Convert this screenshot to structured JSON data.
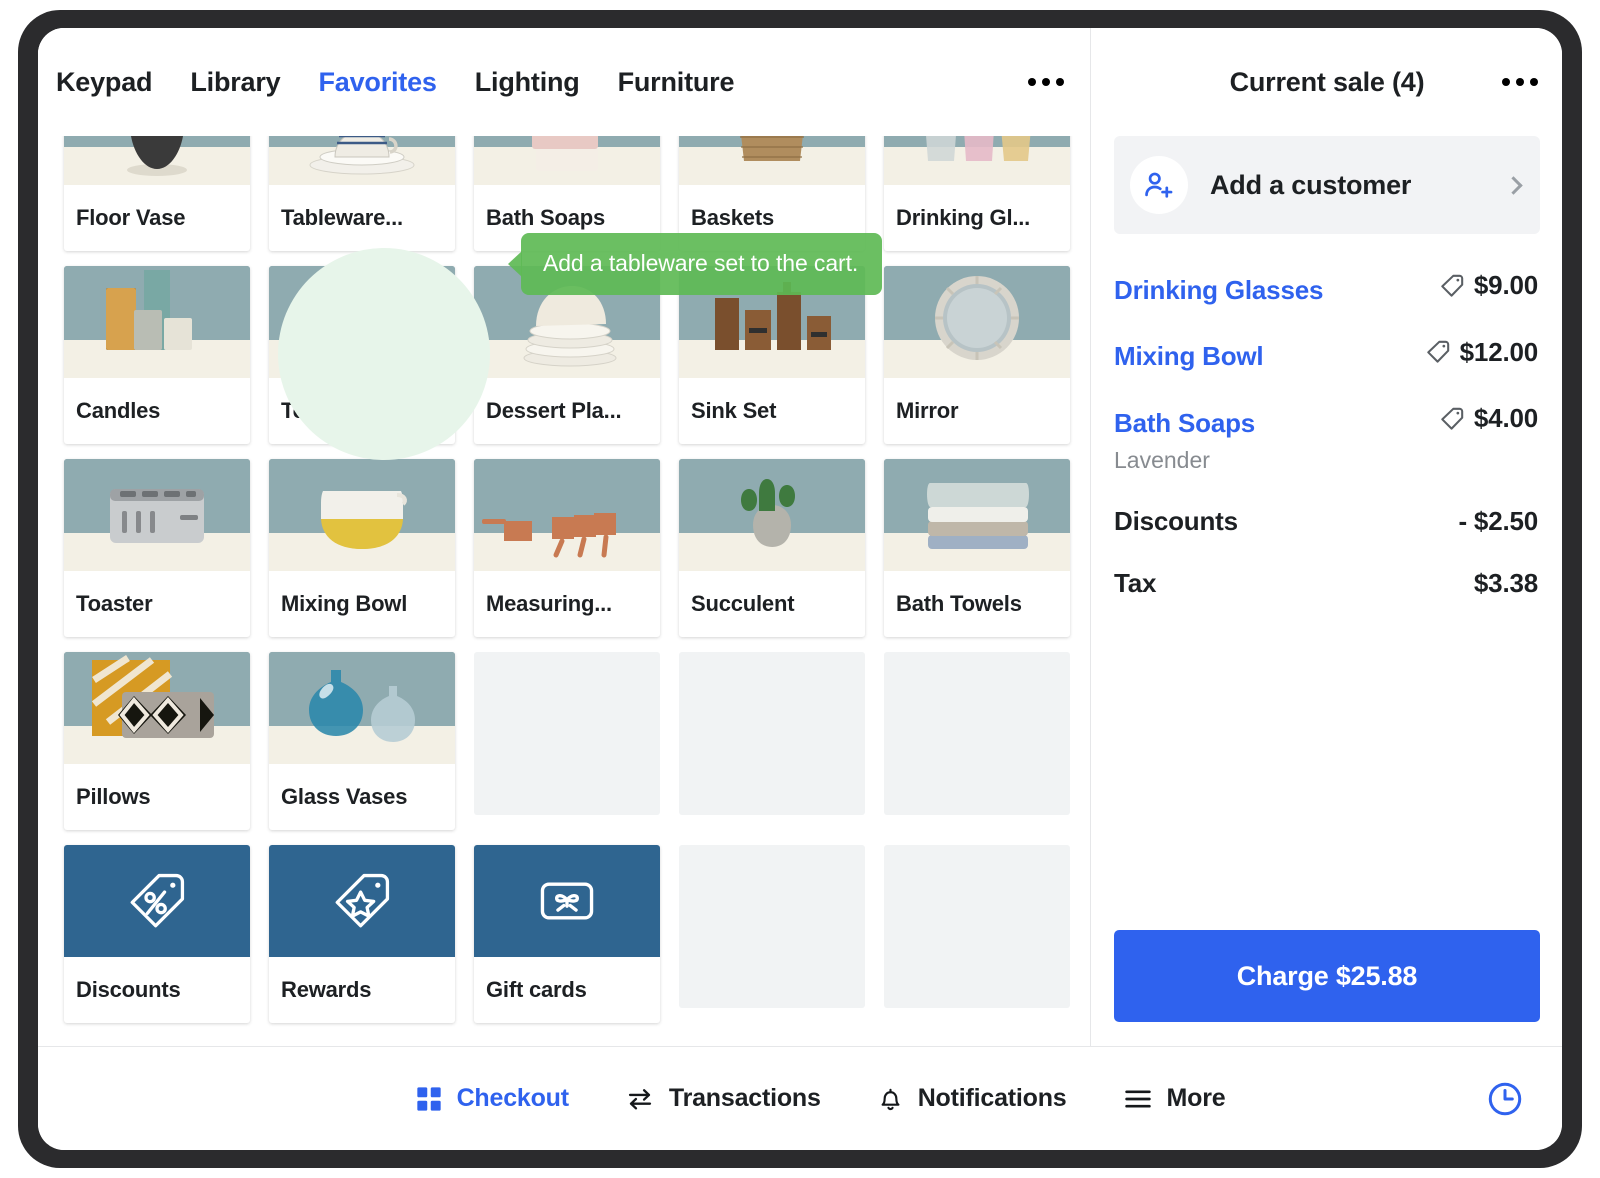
{
  "tabs": [
    {
      "label": "Keypad",
      "active": false
    },
    {
      "label": "Library",
      "active": false
    },
    {
      "label": "Favorites",
      "active": true
    },
    {
      "label": "Lighting",
      "active": false
    },
    {
      "label": "Furniture",
      "active": false
    }
  ],
  "overflow_menu_label": "•••",
  "tooltip": {
    "text": "Add a tableware set to the cart.",
    "color": "#5eba55"
  },
  "grid": {
    "tiles": [
      {
        "label": "Floor Vase",
        "kind": "product",
        "art": "floor-vase"
      },
      {
        "label": "Tableware...",
        "kind": "product",
        "art": "tableware",
        "highlighted": true
      },
      {
        "label": "Bath Soaps",
        "kind": "product",
        "art": "bath-soaps"
      },
      {
        "label": "Baskets",
        "kind": "product",
        "art": "baskets"
      },
      {
        "label": "Drinking Gl...",
        "kind": "product",
        "art": "drinking-glasses"
      },
      {
        "label": "Candles",
        "kind": "product",
        "art": "candles"
      },
      {
        "label": "Teapot",
        "kind": "product",
        "art": "teapot"
      },
      {
        "label": "Dessert Pla...",
        "kind": "product",
        "art": "dessert-plates"
      },
      {
        "label": "Sink Set",
        "kind": "product",
        "art": "sink-set"
      },
      {
        "label": "Mirror",
        "kind": "product",
        "art": "mirror"
      },
      {
        "label": "Toaster",
        "kind": "product",
        "art": "toaster"
      },
      {
        "label": "Mixing Bowl",
        "kind": "product",
        "art": "mixing-bowl"
      },
      {
        "label": "Measuring...",
        "kind": "product",
        "art": "measuring-cups"
      },
      {
        "label": "Succulent",
        "kind": "product",
        "art": "succulent"
      },
      {
        "label": "Bath Towels",
        "kind": "product",
        "art": "bath-towels"
      },
      {
        "label": "Pillows",
        "kind": "product",
        "art": "pillows"
      },
      {
        "label": "Glass Vases",
        "kind": "product",
        "art": "glass-vases"
      },
      {
        "label": "",
        "kind": "empty",
        "art": ""
      },
      {
        "label": "",
        "kind": "empty",
        "art": ""
      },
      {
        "label": "",
        "kind": "empty",
        "art": ""
      },
      {
        "label": "Discounts",
        "kind": "action",
        "art": "discount-tag-icon"
      },
      {
        "label": "Rewards",
        "kind": "action",
        "art": "reward-tag-icon"
      },
      {
        "label": "Gift cards",
        "kind": "action",
        "art": "gift-card-icon"
      },
      {
        "label": "",
        "kind": "empty",
        "art": ""
      },
      {
        "label": "",
        "kind": "empty",
        "art": ""
      }
    ],
    "action_tile_color": "#2f6590"
  },
  "sale": {
    "title": "Current sale (4)",
    "add_customer_label": "Add a customer",
    "items": [
      {
        "name": "Drinking Glasses",
        "price": "$9.00",
        "variant": "",
        "has_tag": true
      },
      {
        "name": "Mixing Bowl",
        "price": "$12.00",
        "variant": "",
        "has_tag": true
      },
      {
        "name": "Bath Soaps",
        "price": "$4.00",
        "variant": "Lavender",
        "has_tag": true
      }
    ],
    "totals": [
      {
        "label": "Discounts",
        "value": "- $2.50"
      },
      {
        "label": "Tax",
        "value": "$3.38"
      }
    ],
    "charge_label": "Charge $25.88",
    "accent_color": "#2f62ee"
  },
  "bottom_nav": {
    "items": [
      {
        "label": "Checkout",
        "icon": "grid-icon",
        "active": true
      },
      {
        "label": "Transactions",
        "icon": "transfer-arrows-icon",
        "active": false
      },
      {
        "label": "Notifications",
        "icon": "bell-icon",
        "active": false
      },
      {
        "label": "More",
        "icon": "hamburger-icon",
        "active": false
      }
    ],
    "clock_icon": "clock-icon"
  }
}
